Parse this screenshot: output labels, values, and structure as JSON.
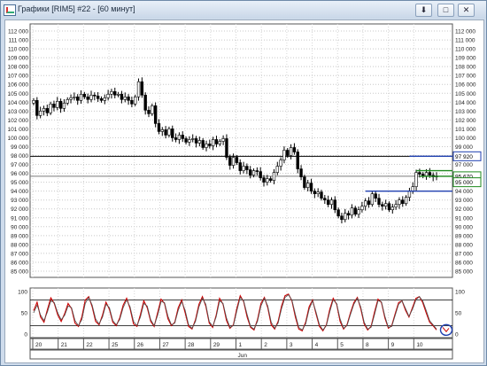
{
  "window": {
    "title": "Графики [RIM5] #22 - [60 минут]",
    "buttons": {
      "download": "⬇",
      "maximize": "□",
      "close": "✕"
    }
  },
  "chart_data": [
    {
      "type": "candlestick",
      "name": "",
      "y_tick_labels": [
        "85 000",
        "86 000",
        "87 000",
        "88 000",
        "89 000",
        "90 000",
        "91 000",
        "92 000",
        "93 000",
        "94 000",
        "95 000",
        "96 000",
        "97 000",
        "98 000",
        "99 000",
        "100 000",
        "101 000",
        "102 000",
        "103 000",
        "104 000",
        "105 000",
        "106 000",
        "107 000",
        "108 000",
        "109 000",
        "110 000",
        "111 000",
        "112 000"
      ],
      "ylim": [
        84300,
        112800
      ],
      "x_tick_labels": [
        "20",
        "21",
        "22",
        "25",
        "26",
        "27",
        "28",
        "29",
        "1",
        "2",
        "3",
        "4",
        "5",
        "8",
        "9",
        "10"
      ],
      "x_period_label": "Jun",
      "price_labels": [
        "97 920",
        "95 670",
        "95 000"
      ],
      "horizontal_lines": [
        {
          "value": 97920,
          "color": "#000000"
        },
        {
          "value": 95670,
          "color": "#7a7a7a"
        }
      ],
      "levels": [
        {
          "value": 97920,
          "color": "#1f3fb0"
        },
        {
          "value": 94000,
          "color": "#1f3fb0"
        },
        {
          "value": 95670,
          "color": "#1f8a1f"
        },
        {
          "value": 96300,
          "color": "#1f8a1f"
        }
      ],
      "close_series": [
        104200,
        102500,
        103000,
        103300,
        102800,
        103800,
        103400,
        104100,
        103300,
        103900,
        104300,
        104500,
        104600,
        104200,
        104900,
        104600,
        104300,
        104800,
        104700,
        104400,
        104200,
        104500,
        104900,
        105200,
        104800,
        104900,
        104300,
        104600,
        104200,
        103800,
        104600,
        106300,
        104800,
        103100,
        102700,
        103600,
        101600,
        100700,
        100900,
        100300,
        101000,
        100000,
        99800,
        100300,
        99900,
        99500,
        99800,
        99900,
        99400,
        99700,
        98900,
        99300,
        99100,
        99800,
        99300,
        99600,
        99900,
        97800,
        96900,
        97800,
        97200,
        96300,
        96800,
        96400,
        95800,
        96300,
        96200,
        95500,
        95000,
        95400,
        95200,
        96100,
        96800,
        97500,
        98600,
        98000,
        98900,
        98400,
        96500,
        95600,
        94400,
        94900,
        94000,
        93700,
        93900,
        93200,
        93000,
        92500,
        93000,
        91900,
        91200,
        90800,
        91500,
        91300,
        92100,
        91400,
        91900,
        92300,
        92900,
        92500,
        93700,
        93200,
        92500,
        92300,
        92600,
        91900,
        92200,
        92500,
        93000,
        92600,
        93300,
        94000,
        94500,
        96100,
        95900,
        95700,
        96100,
        95800,
        95600,
        95700
      ]
    },
    {
      "type": "line",
      "name": "",
      "y_tick_labels": [
        "0",
        "50",
        "100"
      ],
      "ylim": [
        -8,
        108
      ],
      "reference_lines": [
        80,
        20
      ],
      "series": [
        {
          "name": "",
          "color": "#cc0000",
          "values": [
            55,
            75,
            40,
            28,
            58,
            85,
            72,
            45,
            30,
            48,
            72,
            60,
            26,
            18,
            40,
            80,
            88,
            64,
            30,
            22,
            45,
            75,
            58,
            28,
            20,
            38,
            68,
            84,
            60,
            24,
            18,
            46,
            78,
            62,
            30,
            18,
            50,
            82,
            72,
            36,
            20,
            28,
            62,
            80,
            50,
            18,
            12,
            34,
            70,
            88,
            66,
            26,
            16,
            44,
            84,
            70,
            32,
            14,
            22,
            60,
            90,
            76,
            40,
            16,
            10,
            34,
            72,
            86,
            62,
            22,
            12,
            30,
            66,
            90,
            94,
            78,
            40,
            12,
            8,
            28,
            64,
            80,
            48,
            18,
            8,
            22,
            58,
            84,
            70,
            30,
            12,
            22,
            50,
            74,
            86,
            60,
            24,
            10,
            18,
            52,
            82,
            74,
            38,
            14,
            20,
            48,
            74,
            78,
            56,
            40,
            62,
            84,
            88,
            74,
            50,
            28,
            20,
            10
          ]
        },
        {
          "name": "",
          "color": "#505050",
          "values": [
            50,
            68,
            45,
            32,
            52,
            78,
            74,
            50,
            34,
            44,
            66,
            62,
            32,
            20,
            34,
            72,
            86,
            68,
            36,
            24,
            40,
            70,
            62,
            32,
            22,
            34,
            62,
            80,
            64,
            30,
            20,
            40,
            72,
            66,
            34,
            20,
            44,
            76,
            74,
            42,
            22,
            26,
            56,
            76,
            56,
            22,
            14,
            30,
            64,
            84,
            70,
            30,
            18,
            40,
            78,
            72,
            38,
            16,
            20,
            54,
            86,
            78,
            46,
            18,
            12,
            30,
            66,
            84,
            66,
            28,
            14,
            26,
            60,
            86,
            92,
            80,
            46,
            16,
            10,
            24,
            58,
            78,
            52,
            22,
            10,
            20,
            52,
            80,
            72,
            36,
            14,
            20,
            46,
            70,
            84,
            64,
            28,
            12,
            16,
            46,
            78,
            76,
            42,
            16,
            18,
            44,
            70,
            78,
            60,
            42,
            58,
            80,
            88,
            78,
            56,
            32,
            22,
            12
          ]
        }
      ]
    }
  ]
}
